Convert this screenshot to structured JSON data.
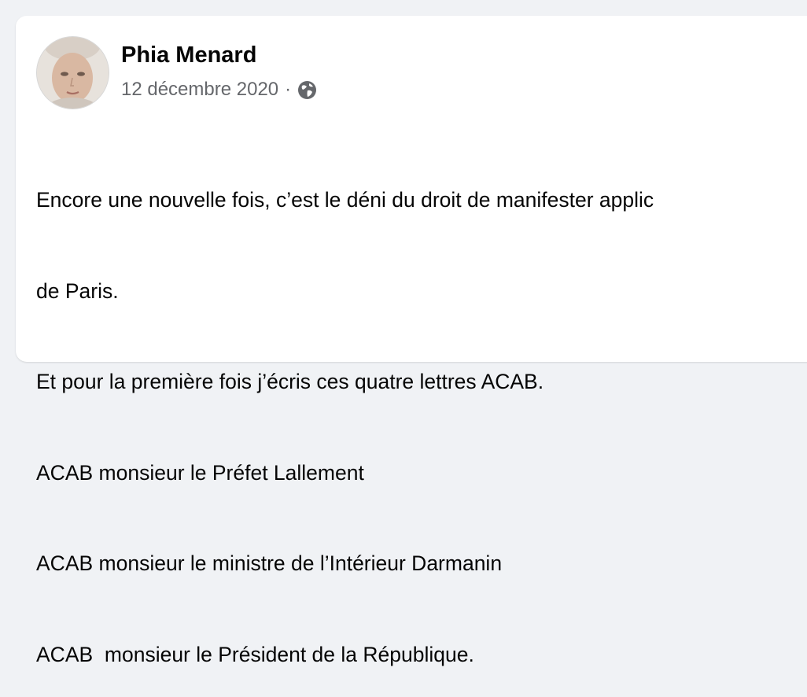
{
  "post": {
    "author": {
      "name": "Phia Menard",
      "avatar_icon": "profile-photo"
    },
    "date": "12 décembre 2020",
    "separator": "·",
    "audience_icon": "globe-icon",
    "lines": [
      "Encore une nouvelle fois, c’est le déni du droit de manifester applic",
      "de Paris.",
      "Et pour la première fois j’écris ces quatre lettres ACAB.",
      "ACAB monsieur le Préfet Lallement",
      "ACAB monsieur le ministre de l’Intérieur Darmanin",
      "ACAB  monsieur le Président de la République."
    ]
  },
  "colors": {
    "page_background": "#f0f2f5",
    "card_background": "#ffffff",
    "primary_text": "#050505",
    "secondary_text": "#65676b"
  }
}
